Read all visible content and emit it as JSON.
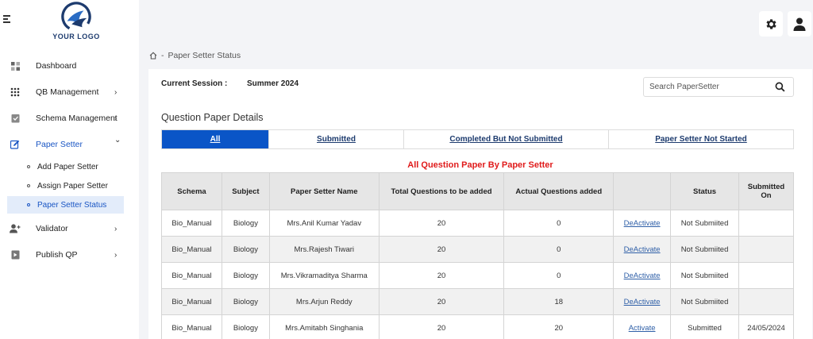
{
  "logo": {
    "text": "YOUR LOGO"
  },
  "sidebar": {
    "items": [
      {
        "label": "Dashboard",
        "icon": "dashboard-icon",
        "chevron": ""
      },
      {
        "label": "QB Management",
        "icon": "grid-icon",
        "chevron": "›"
      },
      {
        "label": "Schema Management",
        "icon": "clipboard-check-icon",
        "chevron": "›"
      },
      {
        "label": "Paper Setter",
        "icon": "edit-icon",
        "chevron": "⌄"
      },
      {
        "label": "Validator",
        "icon": "user-add-icon",
        "chevron": "›"
      },
      {
        "label": "Publish QP",
        "icon": "publish-icon",
        "chevron": "›"
      }
    ],
    "sub_items": [
      {
        "label": "Add Paper Setter"
      },
      {
        "label": "Assign Paper Setter"
      },
      {
        "label": "Paper Setter Status"
      }
    ]
  },
  "breadcrumb": {
    "separator": "-",
    "current": "Paper Setter Status"
  },
  "session": {
    "label": "Current Session :",
    "value": "Summer 2024"
  },
  "search": {
    "placeholder": "Search PaperSetter"
  },
  "section_title": "Question Paper Details",
  "tabs": [
    {
      "label": "All"
    },
    {
      "label": "Submitted"
    },
    {
      "label": "Completed But Not Submitted"
    },
    {
      "label": "Paper Setter Not Started"
    }
  ],
  "table": {
    "caption": "All Question Paper By Paper Setter",
    "headers": [
      "Schema",
      "Subject",
      "Paper Setter Name",
      "Total Questions to be added",
      "Actual Questions added",
      "",
      "Status",
      "Submitted On"
    ],
    "rows": [
      {
        "schema": "Bio_Manual",
        "subject": "Biology",
        "name": "Mrs.Anil Kumar Yadav",
        "total": "20",
        "actual": "0",
        "action": "DeActivate",
        "status": "Not Submiited",
        "submitted_on": ""
      },
      {
        "schema": "Bio_Manual",
        "subject": "Biology",
        "name": "Mrs.Rajesh Tiwari",
        "total": "20",
        "actual": "0",
        "action": "DeActivate",
        "status": "Not Submiited",
        "submitted_on": ""
      },
      {
        "schema": "Bio_Manual",
        "subject": "Biology",
        "name": "Mrs.Vikramaditya Sharma",
        "total": "20",
        "actual": "0",
        "action": "DeActivate",
        "status": "Not Submiited",
        "submitted_on": ""
      },
      {
        "schema": "Bio_Manual",
        "subject": "Biology",
        "name": "Mrs.Arjun Reddy",
        "total": "20",
        "actual": "18",
        "action": "DeActivate",
        "status": "Not Submiited",
        "submitted_on": ""
      },
      {
        "schema": "Bio_Manual",
        "subject": "Biology",
        "name": "Mrs.Amitabh Singhania",
        "total": "20",
        "actual": "20",
        "action": "Activate",
        "status": "Submitted",
        "submitted_on": "24/05/2024"
      }
    ]
  },
  "colors": {
    "primary": "#0a55c7",
    "caption_red": "#e01b1b",
    "link": "#3060a8",
    "logo_blue": "#1d3b6e"
  }
}
